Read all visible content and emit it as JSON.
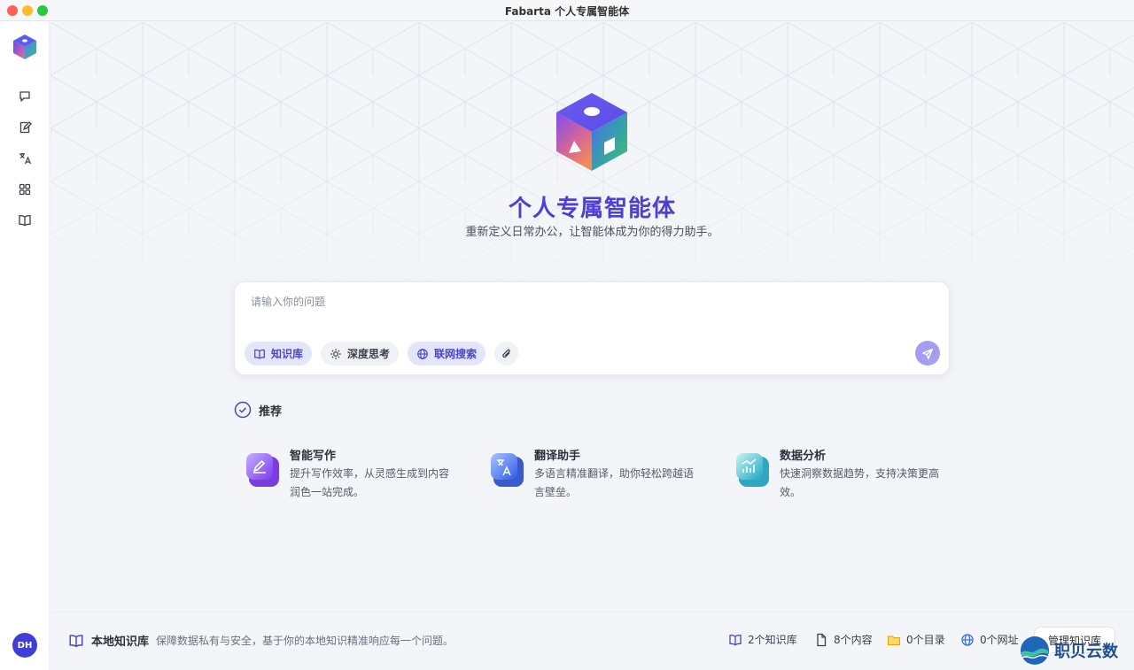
{
  "window": {
    "title": "Fabarta 个人专属智能体"
  },
  "sidebar": {
    "items": [
      {
        "icon": "chat-icon",
        "name": "chat"
      },
      {
        "icon": "edit-icon",
        "name": "write"
      },
      {
        "icon": "translate-icon",
        "name": "translate"
      },
      {
        "icon": "apps-icon",
        "name": "apps"
      },
      {
        "icon": "book-icon",
        "name": "knowledge"
      }
    ],
    "avatar": "DH"
  },
  "hero": {
    "title": "个人专属智能体",
    "subtitle": "重新定义日常办公，让智能体成为你的得力助手。"
  },
  "chat": {
    "placeholder": "请输入你的问题",
    "chips": [
      {
        "label": "知识库",
        "icon": "book-icon",
        "state": "active"
      },
      {
        "label": "深度思考",
        "icon": "gear-icon",
        "state": "inactive"
      },
      {
        "label": "联网搜索",
        "icon": "globe-icon",
        "state": "active"
      },
      {
        "label": "",
        "icon": "paperclip-icon",
        "state": "inactive"
      }
    ],
    "send_icon": "send-icon"
  },
  "recommend": {
    "heading": "推荐",
    "cards": [
      {
        "title": "智能写作",
        "desc": "提升写作效率，从灵感生成到内容润色一站完成。",
        "icon": "write-app-icon",
        "color": "#8b5cf6"
      },
      {
        "title": "翻译助手",
        "desc": "多语言精准翻译，助你轻松跨越语言壁垒。",
        "icon": "translate-app-icon",
        "color": "#3b6ff0"
      },
      {
        "title": "数据分析",
        "desc": "快速洞察数据趋势，支持决策更高效。",
        "icon": "chart-app-icon",
        "color": "#22b8cf"
      }
    ]
  },
  "footer": {
    "title": "本地知识库",
    "desc": "保障数据私有与安全，基于你的本地知识精准响应每一个问题。",
    "stats": [
      {
        "label": "2个知识库",
        "icon": "book-icon"
      },
      {
        "label": "8个内容",
        "icon": "file-icon"
      },
      {
        "label": "0个目录",
        "icon": "folder-icon"
      },
      {
        "label": "0个网址",
        "icon": "globe-icon"
      }
    ],
    "manage_label": "管理知识库"
  },
  "watermark": {
    "text": "职贝云数"
  },
  "colors": {
    "accent": "#4b3fd6",
    "chip_active_bg": "#e3e6fb",
    "send": "#a79df0",
    "avatar": "#3f3fd8"
  }
}
